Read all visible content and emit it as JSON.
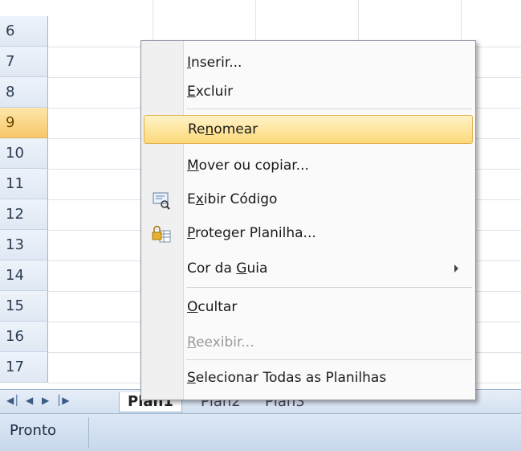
{
  "rows": [
    {
      "num": "6",
      "selected": false
    },
    {
      "num": "7",
      "selected": false
    },
    {
      "num": "8",
      "selected": false
    },
    {
      "num": "9",
      "selected": true
    },
    {
      "num": "10",
      "selected": false
    },
    {
      "num": "11",
      "selected": false
    },
    {
      "num": "12",
      "selected": false
    },
    {
      "num": "13",
      "selected": false
    },
    {
      "num": "14",
      "selected": false
    },
    {
      "num": "15",
      "selected": false
    },
    {
      "num": "16",
      "selected": false
    },
    {
      "num": "17",
      "selected": false
    }
  ],
  "sheet_tabs": {
    "active": "Plan1",
    "others": [
      "Plan2",
      "Plan3"
    ]
  },
  "status": {
    "label": "Pronto"
  },
  "menu": {
    "items": [
      {
        "label": "Inserir...",
        "accel": "I",
        "icon": null,
        "highlighted": false,
        "disabled": false
      },
      {
        "label": "Excluir",
        "accel": "E",
        "icon": null,
        "highlighted": false,
        "disabled": false
      },
      {
        "label": "Renomear",
        "accel": "n",
        "icon": null,
        "highlighted": true,
        "disabled": false
      },
      {
        "label": "Mover ou copiar...",
        "accel": "M",
        "icon": null,
        "highlighted": false,
        "disabled": false
      },
      {
        "label": "Exibir Código",
        "accel": "x",
        "icon": "view-code-icon",
        "highlighted": false,
        "disabled": false
      },
      {
        "label": "Proteger Planilha...",
        "accel": "P",
        "icon": "protect-sheet-icon",
        "highlighted": false,
        "disabled": false
      },
      {
        "label": "Cor da Guia",
        "accel": "G",
        "icon": null,
        "highlighted": false,
        "disabled": false,
        "submenu": true
      },
      {
        "label": "Ocultar",
        "accel": "O",
        "icon": null,
        "highlighted": false,
        "disabled": false
      },
      {
        "label": "Reexibir...",
        "accel": "R",
        "icon": null,
        "highlighted": false,
        "disabled": true
      },
      {
        "label": "Selecionar Todas as Planilhas",
        "accel": "S",
        "icon": null,
        "highlighted": false,
        "disabled": false
      }
    ]
  }
}
